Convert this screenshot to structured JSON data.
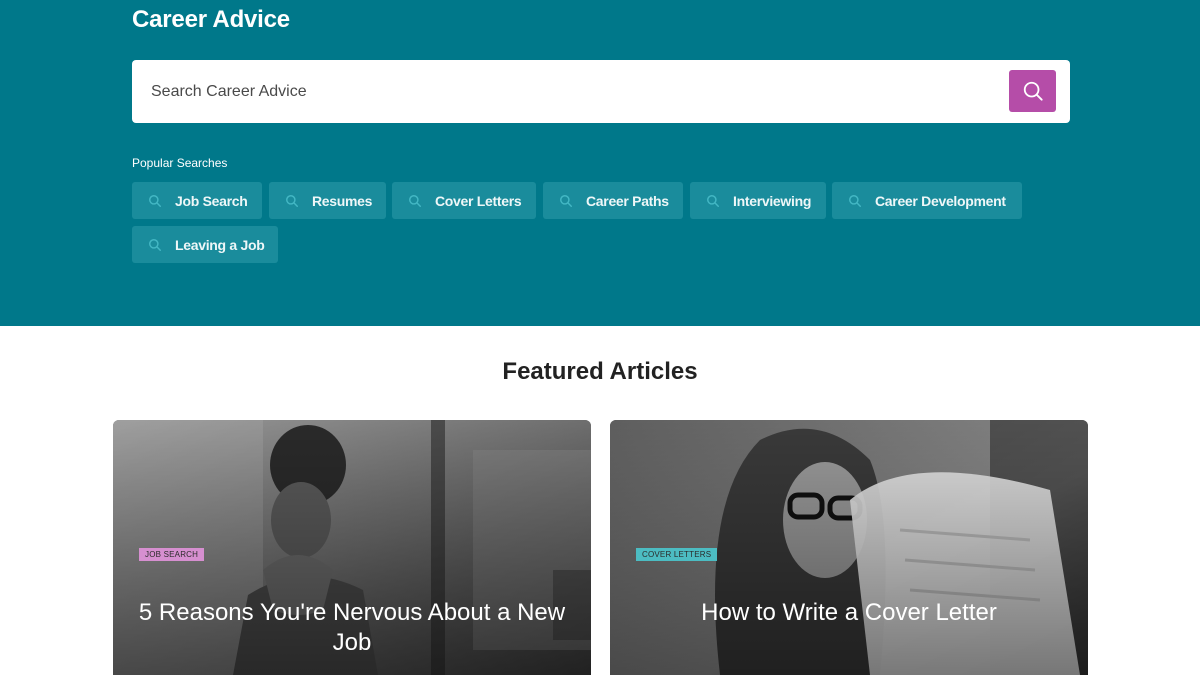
{
  "hero": {
    "title": "Career Advice",
    "background_color": "#00788a",
    "search": {
      "placeholder": "Search Career Advice",
      "value": "",
      "button_icon": "search-icon",
      "button_color": "#b54da8"
    },
    "popular_label": "Popular Searches",
    "popular_searches": [
      {
        "label": "Job Search",
        "icon": "search-icon"
      },
      {
        "label": "Resumes",
        "icon": "search-icon"
      },
      {
        "label": "Cover Letters",
        "icon": "search-icon"
      },
      {
        "label": "Career Paths",
        "icon": "search-icon"
      },
      {
        "label": "Interviewing",
        "icon": "search-icon"
      },
      {
        "label": "Career Development",
        "icon": "search-icon"
      },
      {
        "label": "Leaving a Job",
        "icon": "search-icon"
      }
    ]
  },
  "featured": {
    "title": "Featured Articles",
    "articles": [
      {
        "tag": "JOB SEARCH",
        "tag_color": "#d68fd0",
        "headline": "5 Reasons You're Nervous About a New Job",
        "image": "woman-hands-clasped-photo"
      },
      {
        "tag": "COVER LETTERS",
        "tag_color": "#4cbcc2",
        "headline": "How to Write a Cover Letter",
        "image": "woman-reading-document-photo"
      }
    ]
  }
}
